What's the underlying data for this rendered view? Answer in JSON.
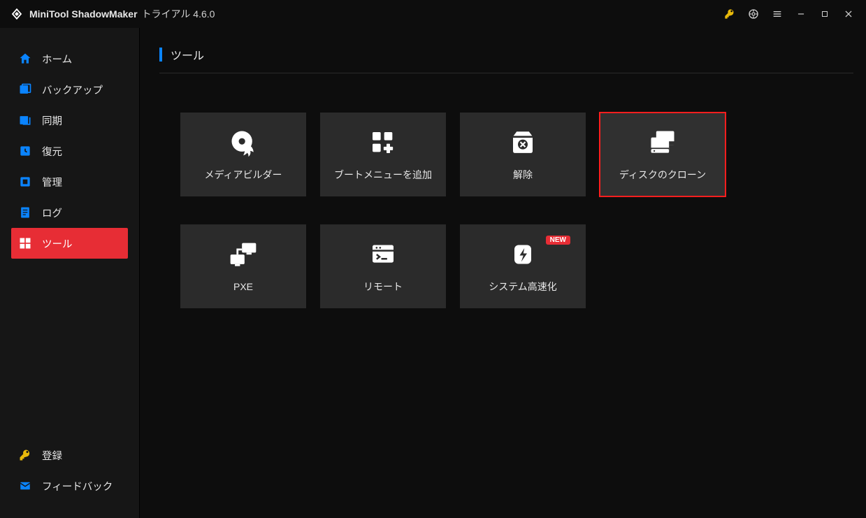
{
  "titlebar": {
    "app_name": "MiniTool ShadowMaker",
    "edition_version": "トライアル 4.6.0"
  },
  "sidebar": {
    "items": [
      {
        "label": "ホーム"
      },
      {
        "label": "バックアップ"
      },
      {
        "label": "同期"
      },
      {
        "label": "復元"
      },
      {
        "label": "管理"
      },
      {
        "label": "ログ"
      },
      {
        "label": "ツール"
      }
    ],
    "bottom": [
      {
        "label": "登録"
      },
      {
        "label": "フィードバック"
      }
    ]
  },
  "main": {
    "section_title": "ツール",
    "tools": [
      {
        "label": "メディアビルダー"
      },
      {
        "label": "ブートメニューを追加"
      },
      {
        "label": "解除"
      },
      {
        "label": "ディスクのクローン"
      },
      {
        "label": "PXE"
      },
      {
        "label": "リモート"
      },
      {
        "label": "システム高速化",
        "badge": "NEW"
      }
    ]
  }
}
